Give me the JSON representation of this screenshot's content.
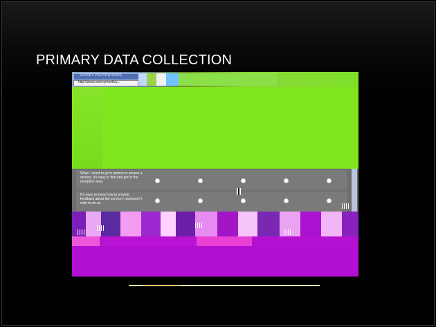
{
  "slide": {
    "title": "PRIMARY DATA COLLECTION"
  },
  "embedded_screenshot": {
    "browser": {
      "tab_label": "SURVEY PREVIEW MODE",
      "url": "http://www.surveymonkey..."
    },
    "survey": {
      "questions": [
        {
          "text": "When I need to go in person to access a service, it's easy to find and get to the reception area.",
          "options_count": 5
        },
        {
          "text": "It's easy to know how to provide feedback about the service I received if I wish to do so.",
          "options_count": 5
        }
      ]
    }
  },
  "colors": {
    "background": "#000000",
    "title_text": "#ffffff",
    "green_area": "#7fe61f",
    "survey_gray": "#6e6e6e",
    "magenta_area": "#b10fd1",
    "bottom_line": "#f6e7b8"
  }
}
